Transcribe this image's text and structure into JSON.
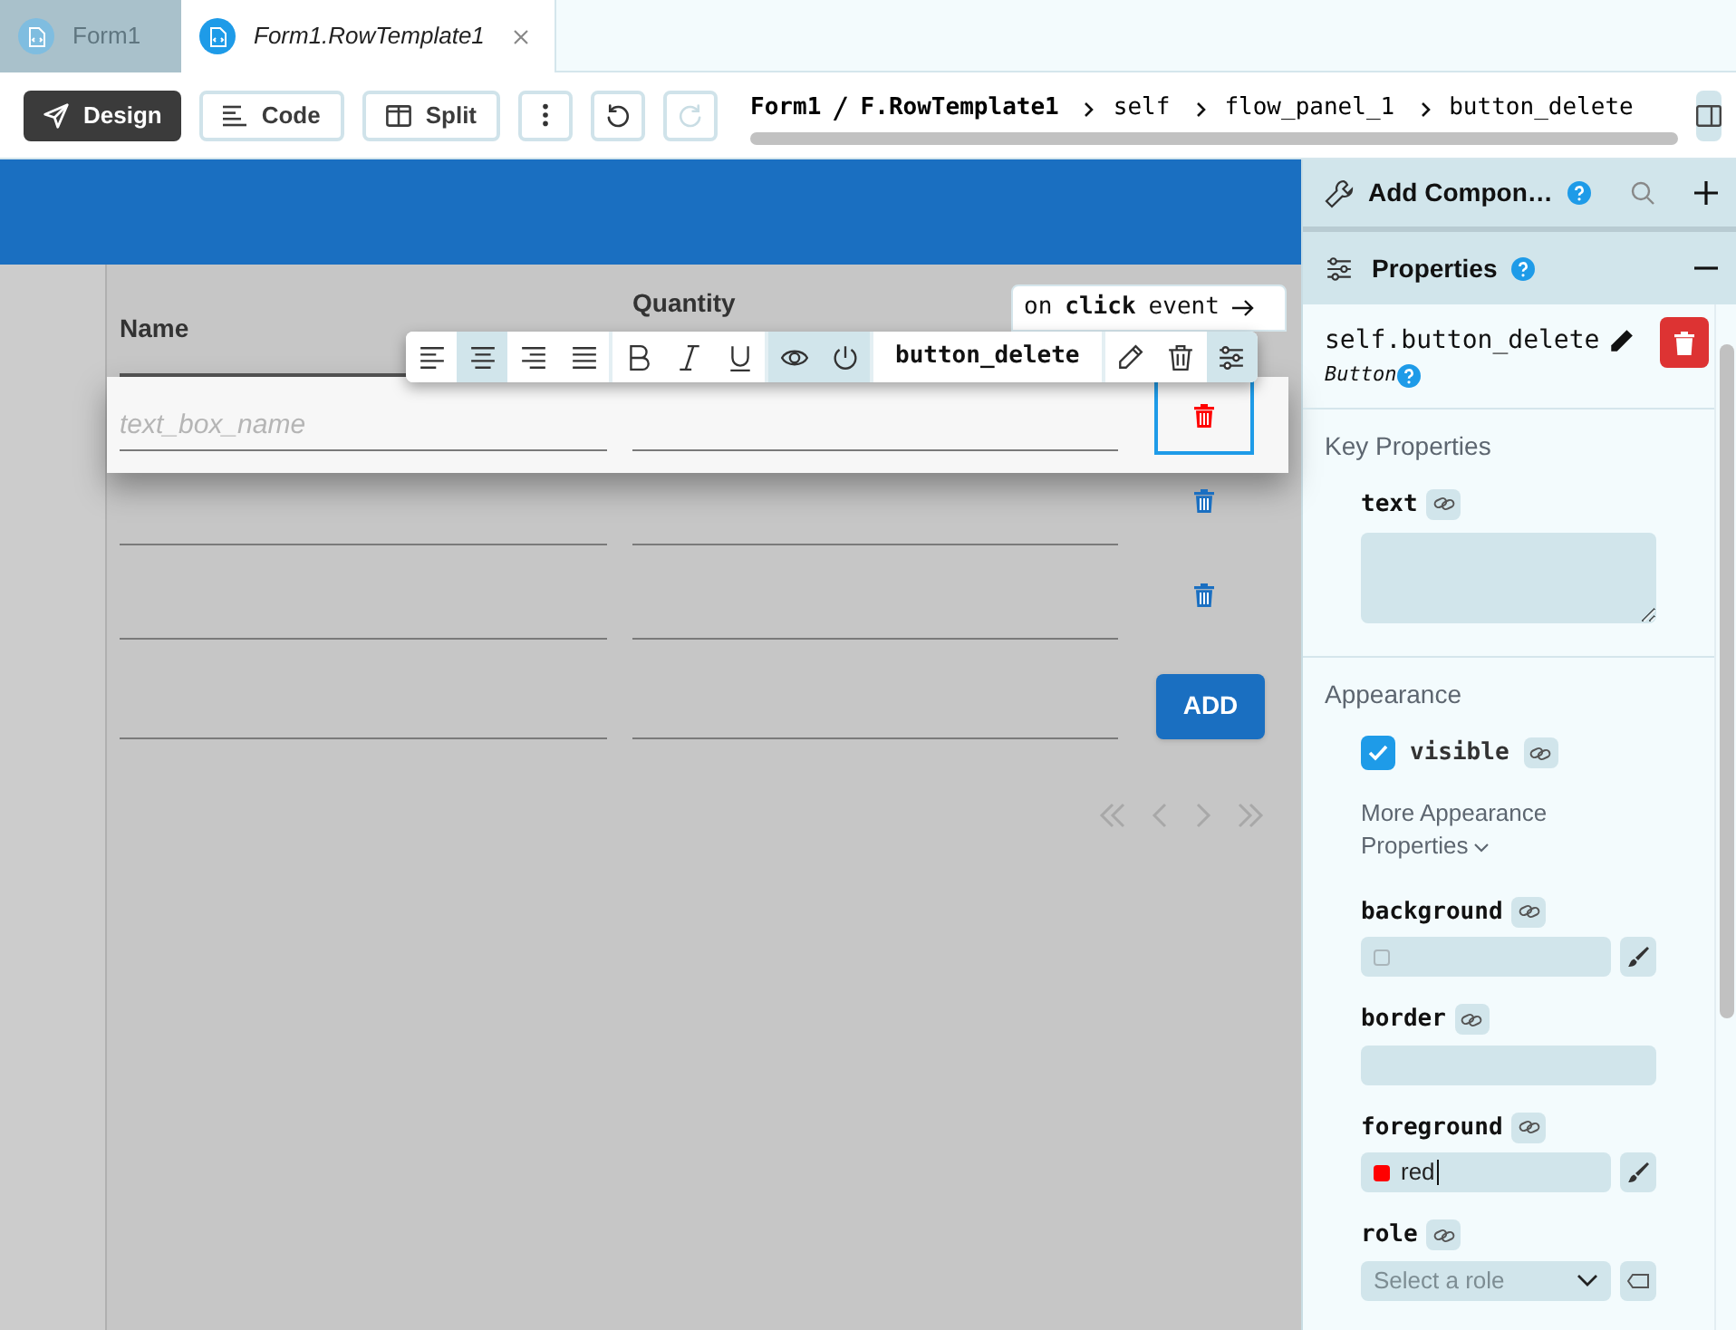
{
  "tabs": [
    {
      "label": "Form1",
      "selected": false
    },
    {
      "label": "Form1.RowTemplate1",
      "selected": true
    }
  ],
  "toolbar": [
    {
      "kind": "mode",
      "label": "Design",
      "selected": true
    },
    {
      "kind": "mode",
      "label": "Code",
      "selected": false
    },
    {
      "kind": "mode",
      "label": "Split",
      "selected": false
    },
    {
      "kind": "more",
      "disabled": false
    },
    {
      "kind": "undo",
      "disabled": false
    },
    {
      "kind": "redo",
      "disabled": true
    }
  ],
  "breadcrumb": {
    "form": "Form1",
    "separator": "/",
    "template": "F.RowTemplate1",
    "path": [
      "self",
      "flow_panel_1",
      "button_delete"
    ]
  },
  "grid": {
    "columns": [
      "Name",
      "Quantity"
    ],
    "rows": [
      {
        "kind": "item",
        "selected": true,
        "placeholder": "text_box_name"
      },
      {
        "kind": "item",
        "selected": false
      },
      {
        "kind": "item",
        "selected": false
      },
      {
        "kind": "footer",
        "button": "ADD"
      }
    ]
  },
  "event_link": {
    "prefix": "on",
    "event": "click",
    "suffix": "event"
  },
  "floating_toolbar": {
    "component": "button_delete",
    "tools": [
      {
        "kind": "align-left",
        "selected": false
      },
      {
        "kind": "align-center",
        "selected": true
      },
      {
        "kind": "align-right",
        "selected": false
      },
      {
        "kind": "justify",
        "selected": false
      },
      {
        "kind": "bold",
        "selected": false
      },
      {
        "kind": "italic",
        "selected": false
      },
      {
        "kind": "underline",
        "selected": false
      },
      {
        "kind": "visible",
        "selected": true
      },
      {
        "kind": "enabled",
        "selected": true
      },
      {
        "kind": "rename",
        "selected": false
      },
      {
        "kind": "delete",
        "selected": false
      },
      {
        "kind": "properties",
        "selected": true
      }
    ]
  },
  "add_components": {
    "title": "Add Compon…"
  },
  "properties": {
    "title": "Properties",
    "expanded": true,
    "component": "self.button_delete",
    "type": "Button",
    "sections": [
      {
        "title": "Key Properties",
        "fields": [
          {
            "kind": "textarea",
            "name": "text"
          }
        ]
      },
      {
        "title": "Appearance",
        "fields": [
          {
            "kind": "checkbox",
            "name": "visible",
            "checked": true
          },
          {
            "kind": "more",
            "label": "More Appearance Properties"
          },
          {
            "kind": "color",
            "name": "background"
          },
          {
            "kind": "text",
            "name": "border"
          },
          {
            "kind": "color",
            "name": "foreground",
            "value": "red",
            "color": "#ff0000"
          },
          {
            "kind": "select",
            "name": "role",
            "placeholder": "Select a role"
          }
        ]
      }
    ]
  }
}
